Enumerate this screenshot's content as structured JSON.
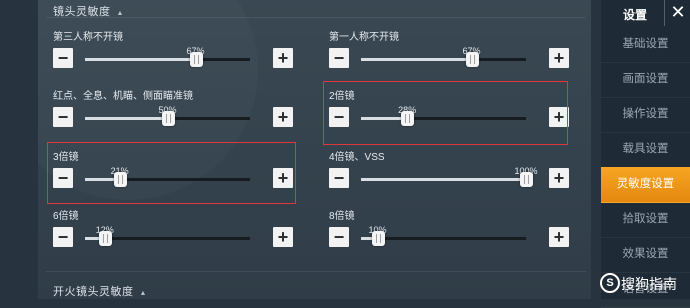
{
  "section_top": {
    "title": "镜头灵敏度",
    "collapse_icon": "triangle-up-icon"
  },
  "settings": [
    {
      "id": "third-person-no-scope",
      "label": "第三人称不开镜",
      "value": "67%",
      "percent": 67,
      "minus": "−",
      "plus": "+"
    },
    {
      "id": "first-person-no-scope",
      "label": "第一人称不开镜",
      "value": "67%",
      "percent": 67,
      "minus": "−",
      "plus": "+"
    },
    {
      "id": "red-dot-holo",
      "label": "红点、全息、机瞄、侧面瞄准镜",
      "value": "50%",
      "percent": 50,
      "minus": "−",
      "plus": "+"
    },
    {
      "id": "scope-2x",
      "label": "2倍镜",
      "value": "28%",
      "percent": 28,
      "minus": "−",
      "plus": "+"
    },
    {
      "id": "scope-3x",
      "label": "3倍镜",
      "value": "21%",
      "percent": 21,
      "minus": "−",
      "plus": "+"
    },
    {
      "id": "scope-4x",
      "label": "4倍镜、VSS",
      "value": "100%",
      "percent": 100,
      "minus": "−",
      "plus": "+"
    },
    {
      "id": "scope-6x",
      "label": "6倍镜",
      "value": "12%",
      "percent": 12,
      "minus": "−",
      "plus": "+"
    },
    {
      "id": "scope-8x",
      "label": "8倍镜",
      "value": "10%",
      "percent": 10,
      "minus": "−",
      "plus": "+"
    }
  ],
  "section_bottom": {
    "title": "开火镜头灵敏度",
    "collapse_icon": "triangle-up-icon"
  },
  "sidebar": {
    "title": "设置",
    "close": "✕",
    "items": [
      {
        "label": "基础设置",
        "active": false
      },
      {
        "label": "画面设置",
        "active": false
      },
      {
        "label": "操作设置",
        "active": false
      },
      {
        "label": "载具设置",
        "active": false
      },
      {
        "label": "灵敏度设置",
        "active": true
      },
      {
        "label": "拾取设置",
        "active": false
      },
      {
        "label": "效果设置",
        "active": false
      },
      {
        "label": "语音设置",
        "active": false
      }
    ]
  },
  "watermark": {
    "logo": "S",
    "text": "搜狗指南"
  },
  "colors": {
    "accent": "#f39a1c",
    "highlight": "#e0383a",
    "panel": "#34424d",
    "sidebar": "#1e2a35"
  }
}
